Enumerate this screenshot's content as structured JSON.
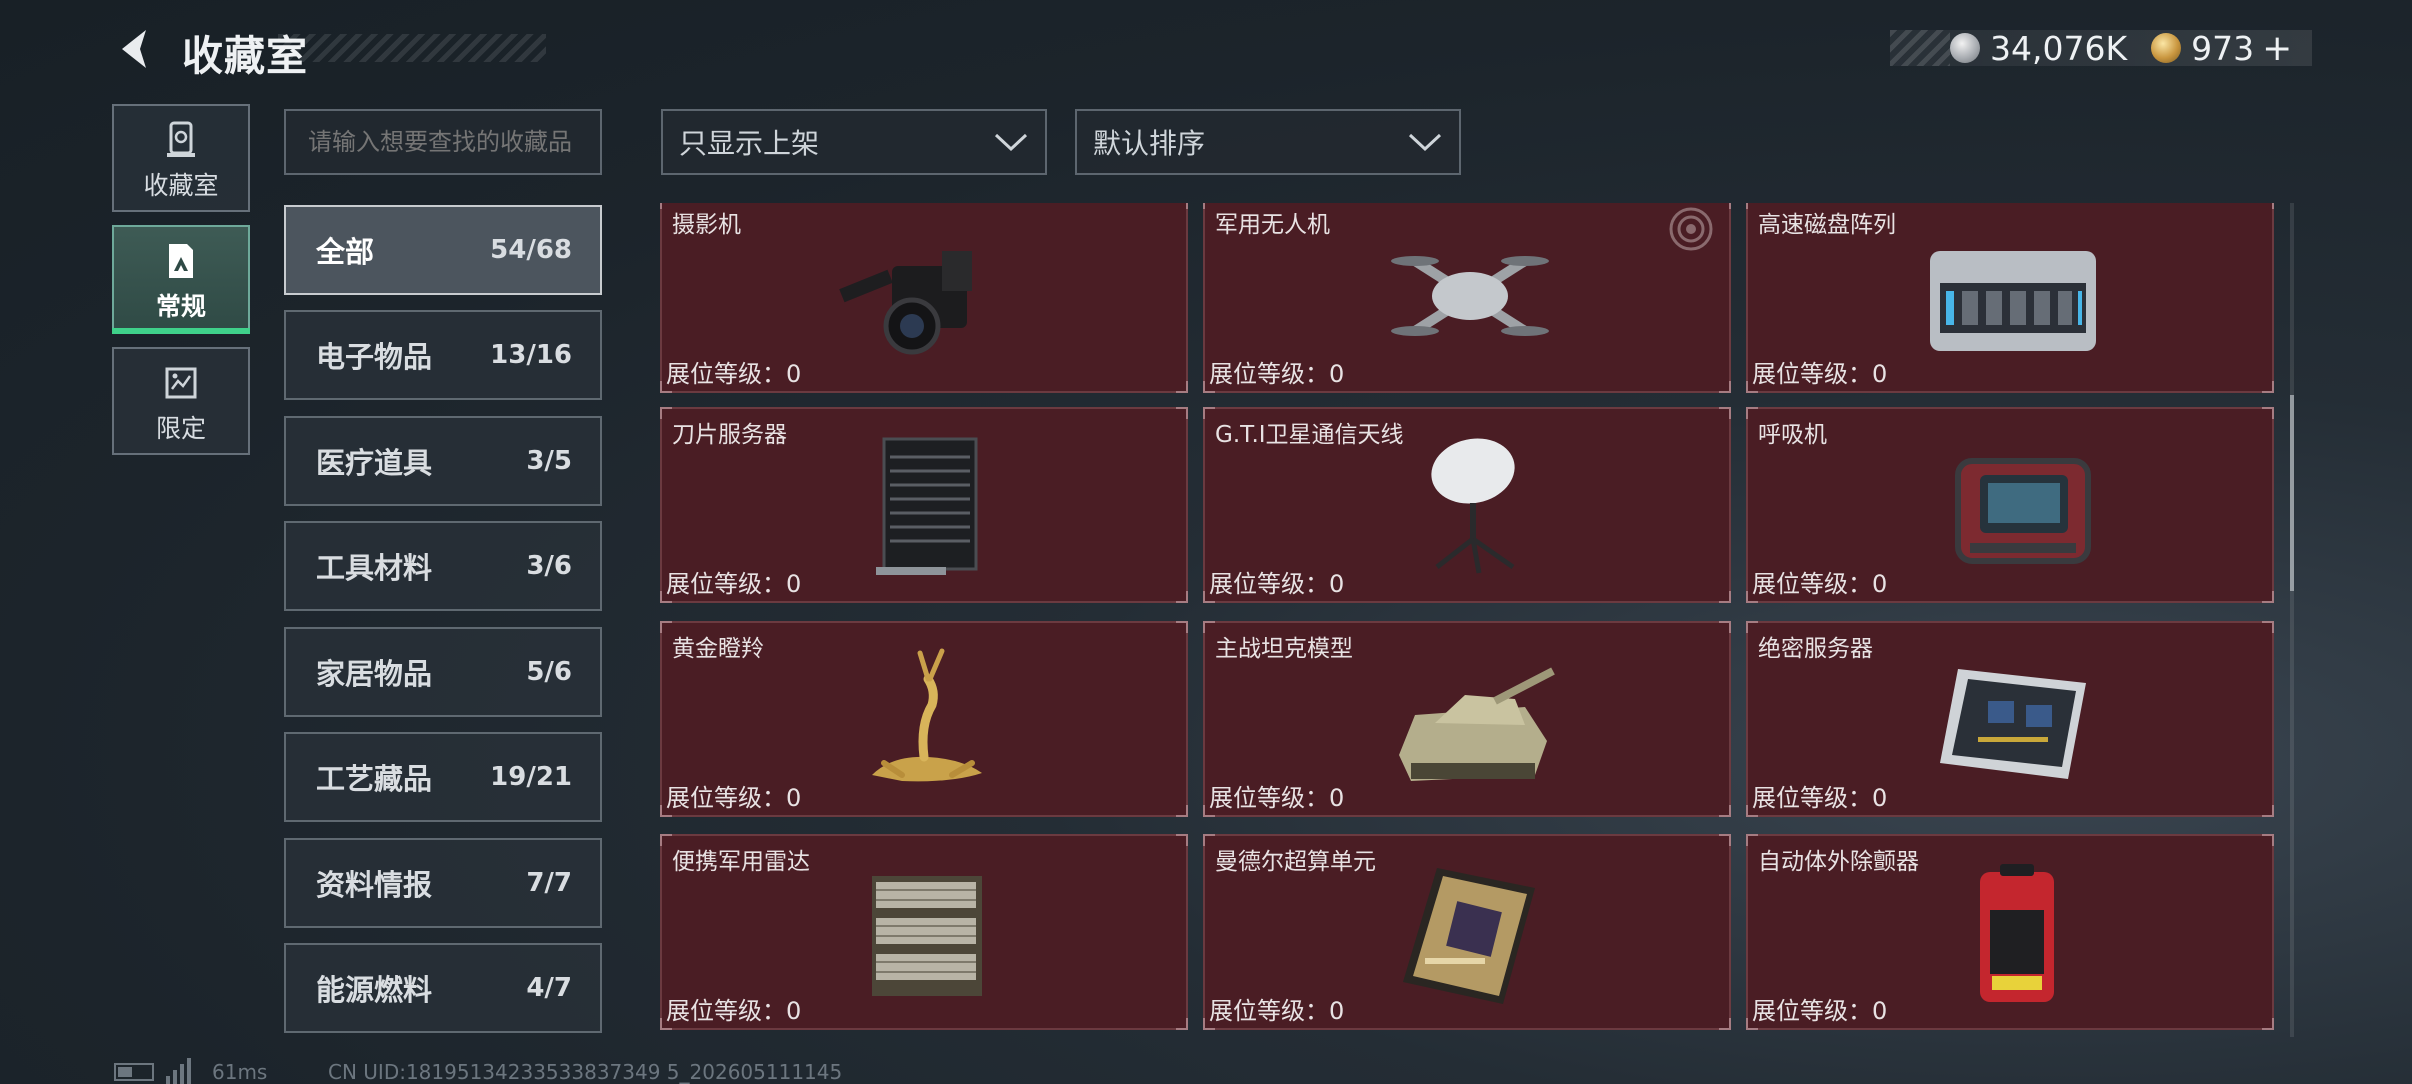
{
  "header": {
    "title": "收藏室",
    "currency_primary": "34,076K",
    "currency_secondary": "973",
    "currency_plus": "+"
  },
  "left_nav": [
    {
      "label": "收藏室",
      "icon": "collection-room-icon",
      "active": false
    },
    {
      "label": "常规",
      "icon": "regular-icon",
      "active": true
    },
    {
      "label": "限定",
      "icon": "limited-icon",
      "active": false
    }
  ],
  "search": {
    "placeholder": "请输入想要查找的收藏品",
    "value": ""
  },
  "filters": {
    "shelf_filter": "只显示上架",
    "sort": "默认排序"
  },
  "categories": [
    {
      "name": "全部",
      "count": "54/68",
      "active": true
    },
    {
      "name": "电子物品",
      "count": "13/16",
      "active": false
    },
    {
      "name": "医疗道具",
      "count": "3/5",
      "active": false
    },
    {
      "name": "工具材料",
      "count": "3/6",
      "active": false
    },
    {
      "name": "家居物品",
      "count": "5/6",
      "active": false
    },
    {
      "name": "工艺藏品",
      "count": "19/21",
      "active": false
    },
    {
      "name": "资料情报",
      "count": "7/7",
      "active": false
    },
    {
      "name": "能源燃料",
      "count": "4/7",
      "active": false
    }
  ],
  "items": [
    {
      "name": "摄影机",
      "level": "展位等级：0",
      "icon": "camera-icon"
    },
    {
      "name": "军用无人机",
      "level": "展位等级：0",
      "icon": "drone-icon"
    },
    {
      "name": "高速磁盘阵列",
      "level": "展位等级：0",
      "icon": "disk-array-icon"
    },
    {
      "name": "刀片服务器",
      "level": "展位等级：0",
      "icon": "blade-server-icon"
    },
    {
      "name": "G.T.I卫星通信天线",
      "level": "展位等级：0",
      "icon": "satellite-dish-icon"
    },
    {
      "name": "呼吸机",
      "level": "展位等级：0",
      "icon": "ventilator-icon"
    },
    {
      "name": "黄金瞪羚",
      "level": "展位等级：0",
      "icon": "golden-gazelle-icon"
    },
    {
      "name": "主战坦克模型",
      "level": "展位等级：0",
      "icon": "tank-model-icon"
    },
    {
      "name": "绝密服务器",
      "level": "展位等级：0",
      "icon": "secret-server-icon"
    },
    {
      "name": "便携军用雷达",
      "level": "展位等级：0",
      "icon": "radar-icon"
    },
    {
      "name": "曼德尔超算单元",
      "level": "展位等级：0",
      "icon": "supercomputer-unit-icon"
    },
    {
      "name": "自动体外除颤器",
      "level": "展位等级：0",
      "icon": "defibrillator-icon"
    }
  ],
  "status_bar": {
    "ping": "61ms",
    "uid": "CN UID:18195134233533837349 5_202605111145"
  }
}
